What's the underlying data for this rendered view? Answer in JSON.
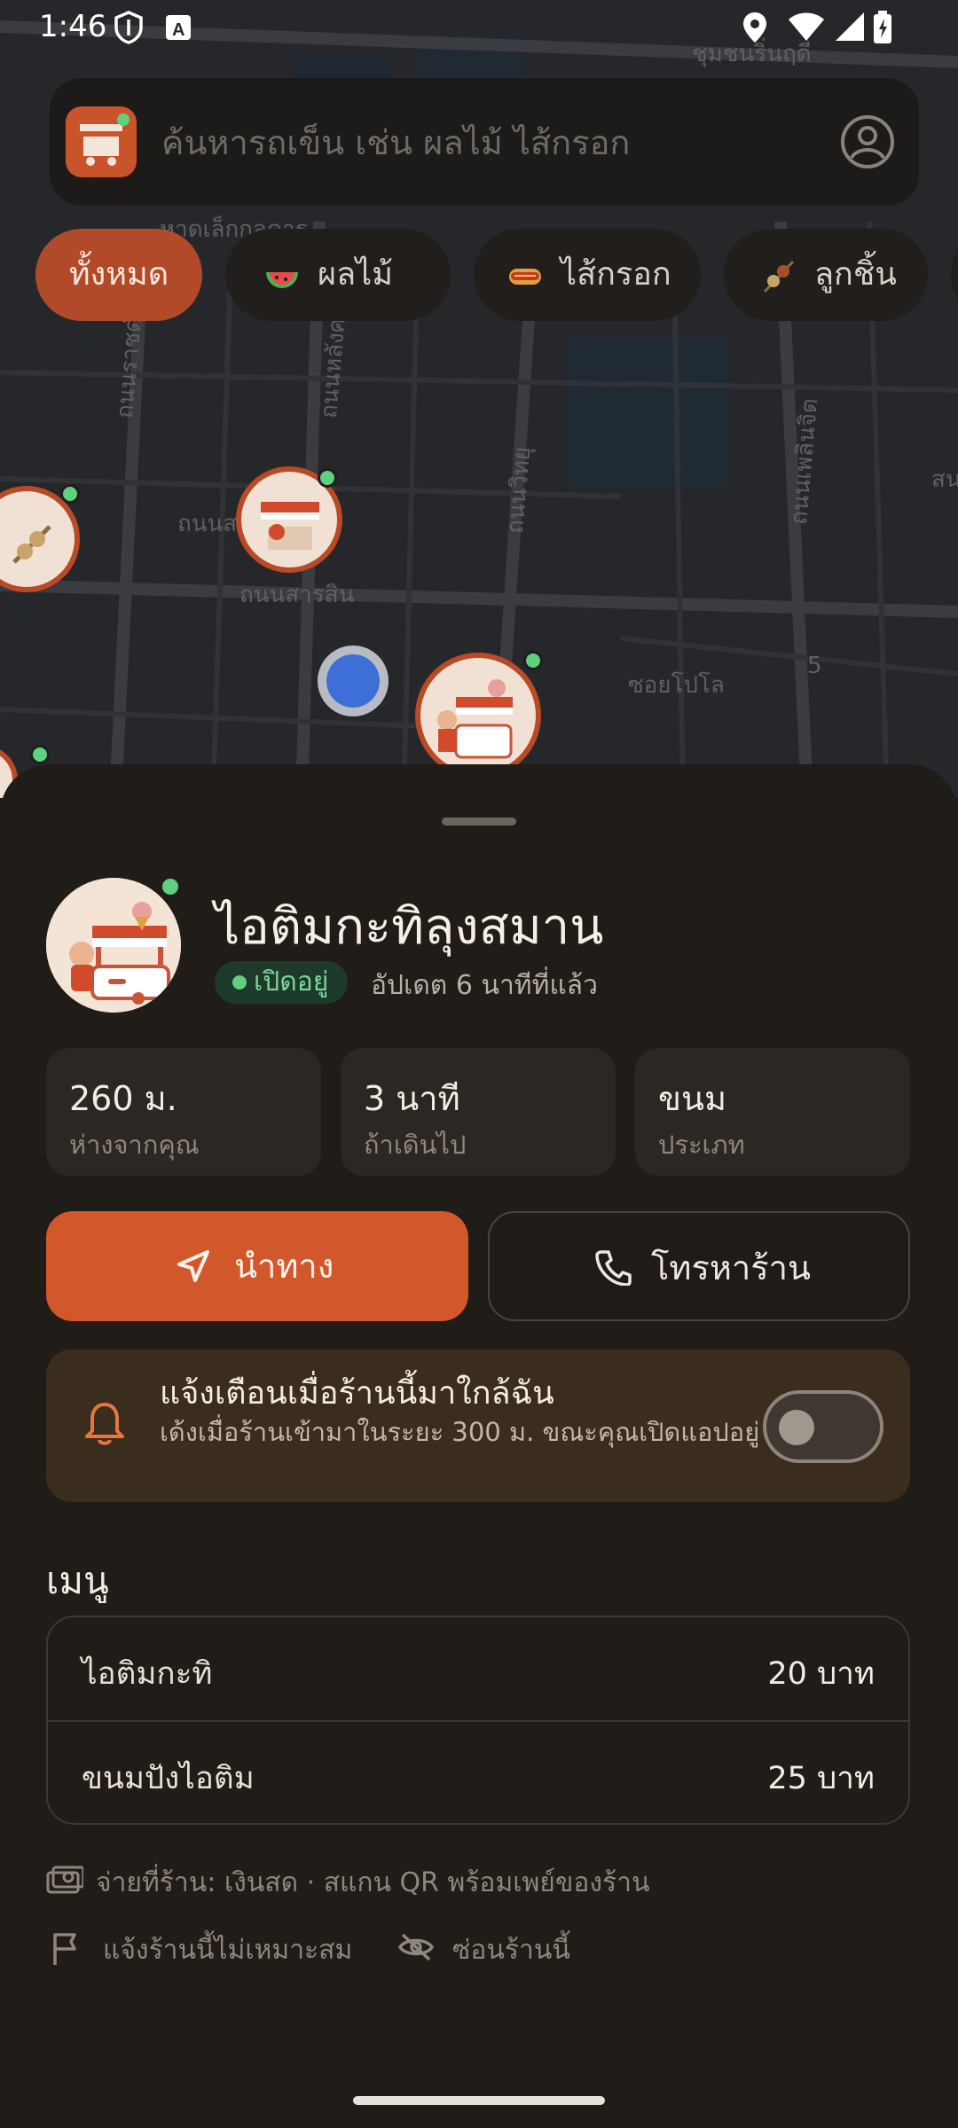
{
  "status_bar": {
    "time": "1:46"
  },
  "search": {
    "placeholder": "ค้นหารถเข็น เช่น ผลไม้ ไส้กรอก"
  },
  "categories": [
    {
      "label": "ทั้งหมด",
      "active": true
    },
    {
      "label": "ผลไม้",
      "icon": "watermelon-icon"
    },
    {
      "label": "ไส้กรอก",
      "icon": "hotdog-icon"
    },
    {
      "label": "ลูกชิ้น",
      "icon": "meatball-skewer-icon"
    }
  ],
  "map": {
    "street_labels": [
      "ชุมชนริ่นฤดี",
      "หาดเล็กกุลคาร",
      "ถนนราชดำริ",
      "ถนนหลังศวน",
      "ถนนสารสิน",
      "ถนนสารสิน",
      "ถนนวิทยุ",
      "ถนนเพลินจิต",
      "ซอยโปโล",
      "5",
      "สน"
    ]
  },
  "shop": {
    "name": "ไอติมกะทิลุงสมาน",
    "status": "เปิดอยู่",
    "updated": "อัปเดต 6 นาทีที่แล้ว",
    "stats": [
      {
        "value": "260 ม.",
        "label": "ห่างจากคุณ"
      },
      {
        "value": "3 นาที",
        "label": "ถ้าเดินไป"
      },
      {
        "value": "ขนม",
        "label": "ประเภท"
      }
    ],
    "navigate_label": "นำทาง",
    "call_label": "โทรหาร้าน",
    "alert": {
      "title": "แจ้งเตือนเมื่อร้านนี้มาใกล้ฉัน",
      "desc": "เด้งเมื่อร้านเข้ามาในระยะ 300 ม. ขณะคุณเปิดแอปอยู่",
      "enabled": false
    },
    "menu_title": "เมนู",
    "menu": [
      {
        "name": "ไอติมกะทิ",
        "price": "20 บาท"
      },
      {
        "name": "ขนมปังไอติม",
        "price": "25 บาท"
      }
    ],
    "payment": "จ่ายที่ร้าน: เงินสด · สแกน QR พร้อมเพย์ของร้าน",
    "report_label": "แจ้งร้านนี้ไม่เหมาะสม",
    "hide_label": "ซ่อนร้านนี้"
  },
  "colors": {
    "accent": "#d2582b",
    "open": "#5fd07d",
    "sheet": "#201c18",
    "alert_bg": "#3a2d1d"
  }
}
